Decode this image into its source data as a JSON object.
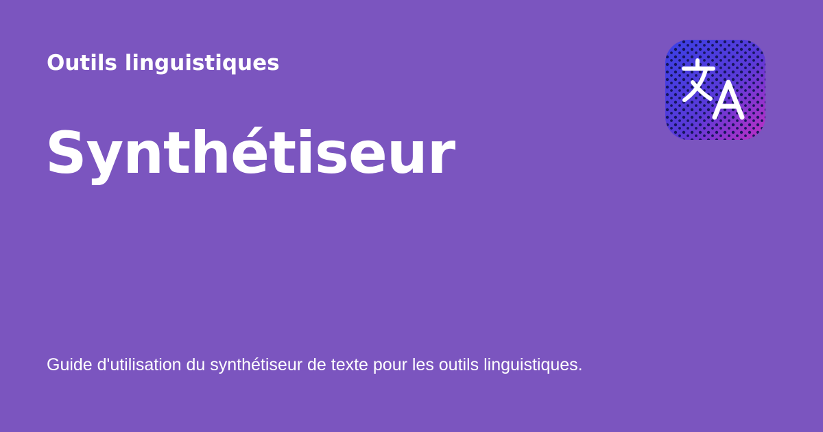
{
  "header": {
    "category": "Outils linguistiques"
  },
  "main": {
    "title": "Synthétiseur",
    "description": "Guide d'utilisation du synthétiseur de texte pour les outils linguistiques."
  },
  "icon": {
    "name": "translate-icon",
    "gradient_start": "#3b3fe0",
    "gradient_end": "#b52fc9"
  },
  "colors": {
    "background": "#7b55bf",
    "text": "#ffffff"
  }
}
